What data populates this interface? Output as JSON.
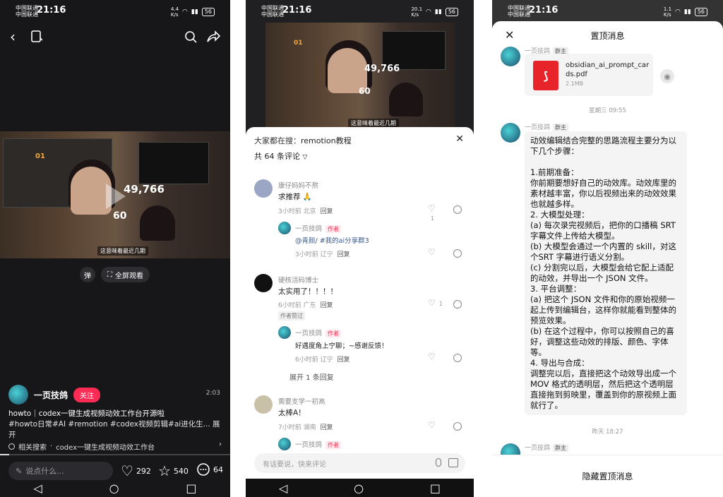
{
  "status": {
    "carrier1": "中国联通",
    "carrier2": "中国联通",
    "time": "21:16",
    "net1": "4.4\nK/s",
    "net2": "20.1\nK/s",
    "net3": "1.1\nK/s",
    "battery": "56"
  },
  "video_panel": {
    "video_numbers": [
      "01",
      "49,766",
      "60"
    ],
    "video_subtitle": "这意味着最近几期",
    "danmu_label": "弹",
    "fullscreen_label": "全屏观看",
    "author": "一页技鸽",
    "follow_label": "关注",
    "duration": "2:03",
    "title": "howto｜codex一键生成视频动效工作台开源啦",
    "tags": "#howto日常#AI #remotion #codex视频剪辑#ai进化生... 展开",
    "related_prefix": "相关搜索",
    "related_text": "codex一键生成视频动效工作台",
    "progress_fraction": 0.04,
    "comment_placeholder": "说点什么...",
    "likes": "292",
    "stars": "540",
    "comments": "64"
  },
  "comments_panel": {
    "search_prefix": "大家都在搜：",
    "search_term": "remotion教程",
    "count_label": "共 64 条评论",
    "close_label": "✕",
    "items": [
      {
        "name": "康仔妈妈不熬",
        "text": "求推荐 🙏",
        "meta": "3小时前 北京",
        "reply": "回复",
        "likes": "1",
        "avatar": "#9aa6c4"
      },
      {
        "name": "一页技鸽",
        "tag": "作者",
        "text": "@青颜/ #我的ai分享群3",
        "meta": "3小时前 辽宁",
        "reply": "回复"
      },
      {
        "name": "硬核活码博士",
        "text": "太实用了！！！！",
        "meta": "6小时前 广东",
        "reply": "回复",
        "likes": "1",
        "liked": "作者赞过",
        "avatar": "#111111"
      },
      {
        "name": "一页技鸽",
        "tag": "作者",
        "text": "好遇度角上宁聊；~感谢反馈！",
        "meta": "6小时前 辽宁",
        "reply": "回复"
      },
      {
        "name": "需要支学一初高",
        "text": "太棒A！",
        "meta": "7小时前 湖南",
        "reply": "回复",
        "avatar": "#c9c0a8"
      },
      {
        "name": "一页技鸽",
        "tag": "作者"
      }
    ],
    "expand_label": "展开 1 条回复",
    "input_placeholder": "有话要说，快来评论"
  },
  "pinned_panel": {
    "title": "置顶消息",
    "sender": "一页技鸽",
    "owner_tag": "群主",
    "file_name": "obsidian_ai_prompt_cards.pdf",
    "file_size": "2.1MB",
    "time1": "星期三 09:55",
    "message_lines": [
      "动效编辑结合完整的思路流程主要分为以下几个步骤：",
      "",
      "1.前期准备：",
      "你前期要想好自己的动效库。动效库里的素材越丰富，你以后视频出来的动效效果也就越多样。",
      "2. 大模型处理：",
      "(a) 每次录完视频后，把你的口播稿 SRT 字幕文件上传给大模型。",
      "(b) 大模型会通过一个内置的 skill，对这个SRT 字幕进行语义分割。",
      "(c) 分割完以后，大模型会给它配上适配的动效，并导出一个 JSON 文件。",
      "3. 平台调整：",
      "(a) 把这个 JSON 文件和你的原始视频一起上传到编辑台，这样你就能看到整体的预览效果。",
      "(b) 在这个过程中，你可以按照自己的喜好，调整这些动效的排版、颜色、字体等。",
      "4. 导出与合成：",
      "调整完以后，直接把这个动效导出成一个 MOV 格式的透明层，然后把这个透明层直接拖到剪映里，覆盖到你的原视频上面就行了。"
    ],
    "time2": "昨天 18:27",
    "hide_label": "隐藏置顶消息"
  }
}
